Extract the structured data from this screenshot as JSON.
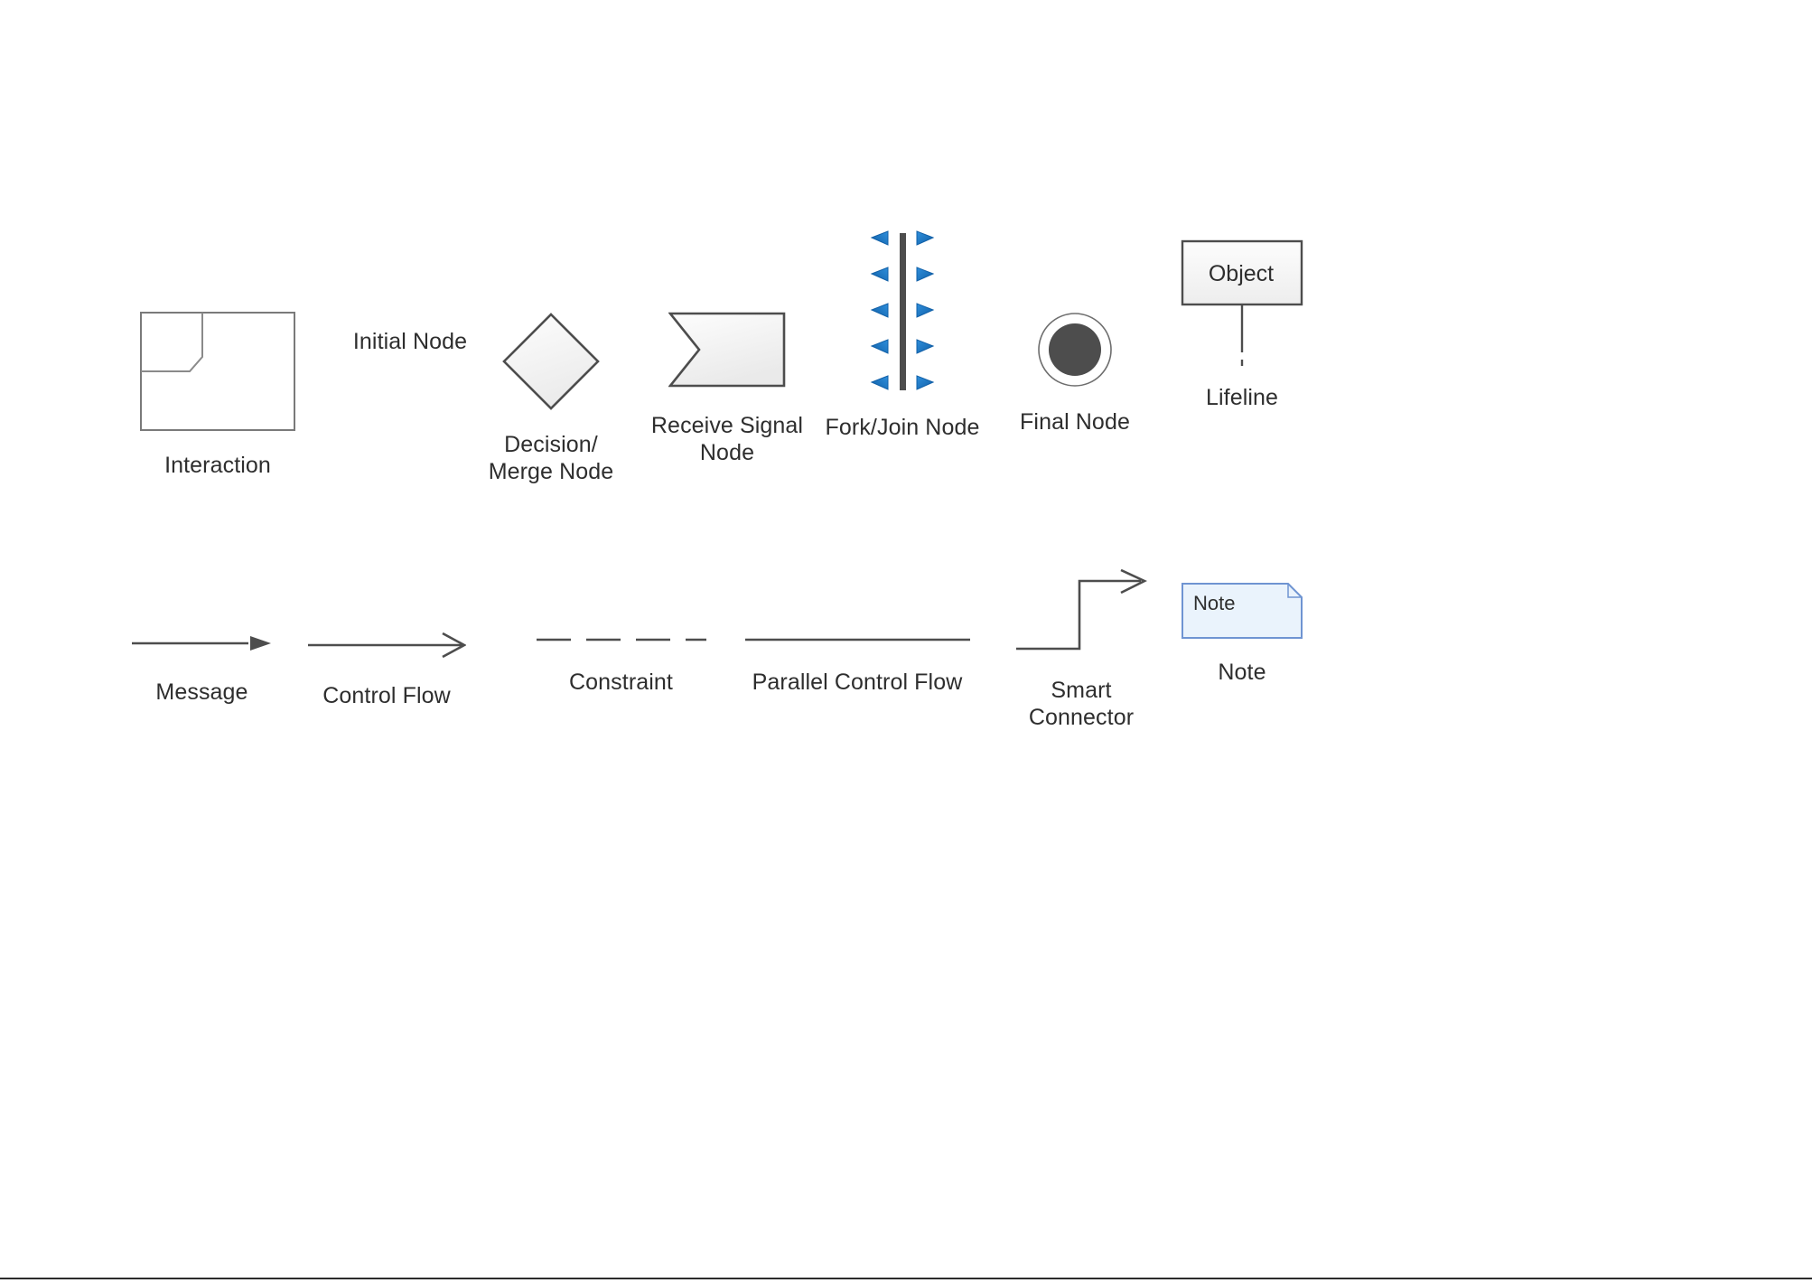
{
  "page": {
    "title": "UML Activity & Sequence Diagram Shapes Library",
    "background_color": "#ffffff",
    "label_color": "#2e2e2e",
    "shape_stroke_color": "#4d4d4d",
    "shape_fill_color": "#f5f5f5",
    "accent_blue": "#1f7ed0",
    "note_border_color": "#6f94d2",
    "note_fill_color": "#eaf3fc"
  },
  "shapes_row1": [
    {
      "id": "interaction",
      "label": "Interaction",
      "icon": "interaction-frame-icon"
    },
    {
      "id": "initial",
      "label": "Initial Node",
      "icon": "filled-circle-icon"
    },
    {
      "id": "decision",
      "label": "Decision/\nMerge Node",
      "icon": "diamond-icon"
    },
    {
      "id": "receive",
      "label": "Receive Signal\nNode",
      "icon": "receive-signal-flag-icon"
    },
    {
      "id": "fork",
      "label": "Fork/Join Node",
      "icon": "fork-join-bar-icon"
    },
    {
      "id": "final",
      "label": "Final Node",
      "icon": "final-node-ring-icon"
    },
    {
      "id": "lifeline",
      "label": "Lifeline",
      "icon": "lifeline-icon",
      "box_text": "Object"
    }
  ],
  "shapes_row2": [
    {
      "id": "message",
      "label": "Message",
      "icon": "solid-arrow-icon"
    },
    {
      "id": "control",
      "label": "Control Flow",
      "icon": "open-arrow-icon"
    },
    {
      "id": "constraint",
      "label": "Constraint",
      "icon": "dashed-line-icon"
    },
    {
      "id": "parallel",
      "label": "Parallel Control Flow",
      "icon": "solid-line-icon"
    },
    {
      "id": "smart",
      "label": "Smart Connector",
      "icon": "elbow-arrow-icon"
    },
    {
      "id": "note",
      "label": "Note",
      "icon": "note-page-icon",
      "box_text": "Note"
    }
  ],
  "fork_join": {
    "left_arrow_count": 5,
    "right_arrow_count": 5,
    "arrow_color": "#1f7ed0",
    "bar_color": "#4d4d4d"
  }
}
